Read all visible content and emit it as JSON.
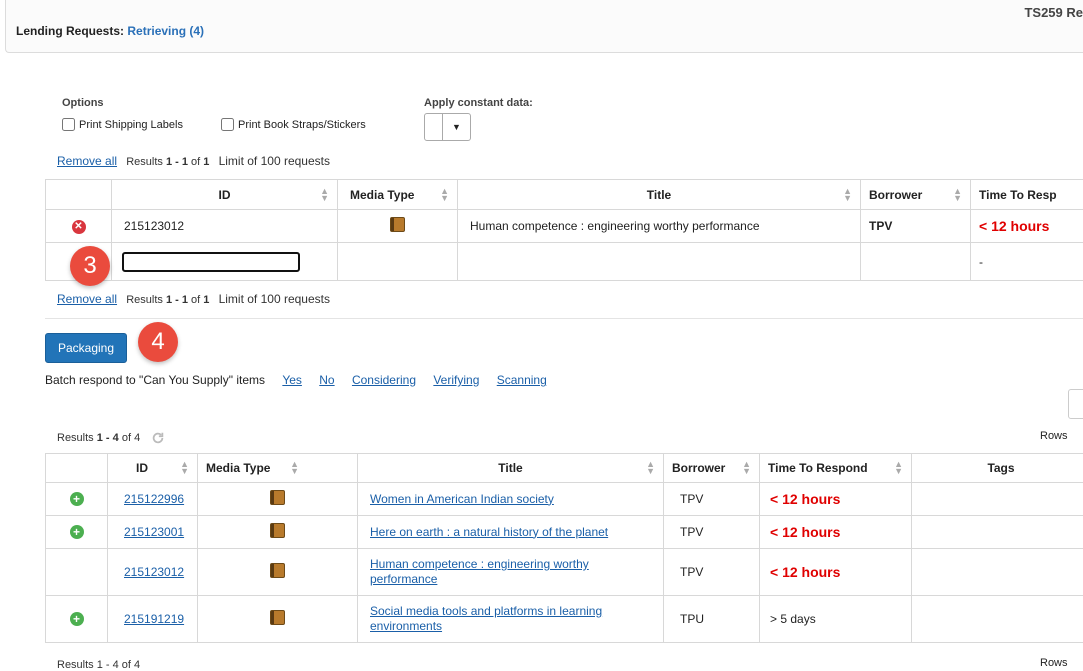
{
  "header": {
    "title_prefix": "Lending Requests:",
    "title_crumb": "Retrieving (4)",
    "code": "TS259 Re"
  },
  "options": {
    "label": "Options",
    "print_shipping": "Print Shipping Labels",
    "print_straps": "Print Book Straps/Stickers",
    "constant_label": "Apply constant data:"
  },
  "top_results": {
    "remove_all": "Remove all",
    "results_prefix": "Results",
    "range": "1 - 1",
    "of": "of",
    "total": "1",
    "limit": "Limit of 100 requests"
  },
  "top_table": {
    "headers": [
      "ID",
      "Media Type",
      "Title",
      "Borrower",
      "Time To Resp"
    ],
    "row": {
      "id": "215123012",
      "title": "Human competence : engineering worthy performance",
      "borrower": "TPV",
      "time": "< 12 hours"
    },
    "input_row_time": "-"
  },
  "badges": {
    "three": "3",
    "four": "4"
  },
  "packaging": {
    "label": "Packaging"
  },
  "batch": {
    "label": "Batch respond to \"Can You Supply\" items",
    "options": [
      "Yes",
      "No",
      "Considering",
      "Verifying",
      "Scanning"
    ]
  },
  "bottom_results": {
    "results_prefix": "Results",
    "range": "1 - 4",
    "of": "of",
    "total": "4",
    "rows_label": "Rows"
  },
  "bottom_table": {
    "headers": [
      "ID",
      "Media Type",
      "Title",
      "Borrower",
      "Time To Respond",
      "Tags"
    ],
    "rows": [
      {
        "id": "215122996",
        "title": "Women in American Indian society",
        "borrower": "TPV",
        "time": "< 12 hours",
        "time_urgent": true,
        "add": true
      },
      {
        "id": "215123001",
        "title": "Here on earth : a natural history of the planet",
        "borrower": "TPV",
        "time": "< 12 hours",
        "time_urgent": true,
        "add": true
      },
      {
        "id": "215123012",
        "title": "Human competence : engineering worthy performance",
        "borrower": "TPV",
        "time": "< 12 hours",
        "time_urgent": true,
        "add": false
      },
      {
        "id": "215191219",
        "title": "Social media tools and platforms in learning environments",
        "borrower": "TPU",
        "time": "> 5 days",
        "time_urgent": false,
        "add": true
      }
    ]
  },
  "footer": {
    "results_partial": "Results 1 - 4 of 4",
    "rows_label": "Rows"
  },
  "colors": {
    "accent": "#2274b8",
    "urgent": "#e00000",
    "badge": "#ea4b3d",
    "add": "#4caf50",
    "remove": "#d9363e"
  }
}
